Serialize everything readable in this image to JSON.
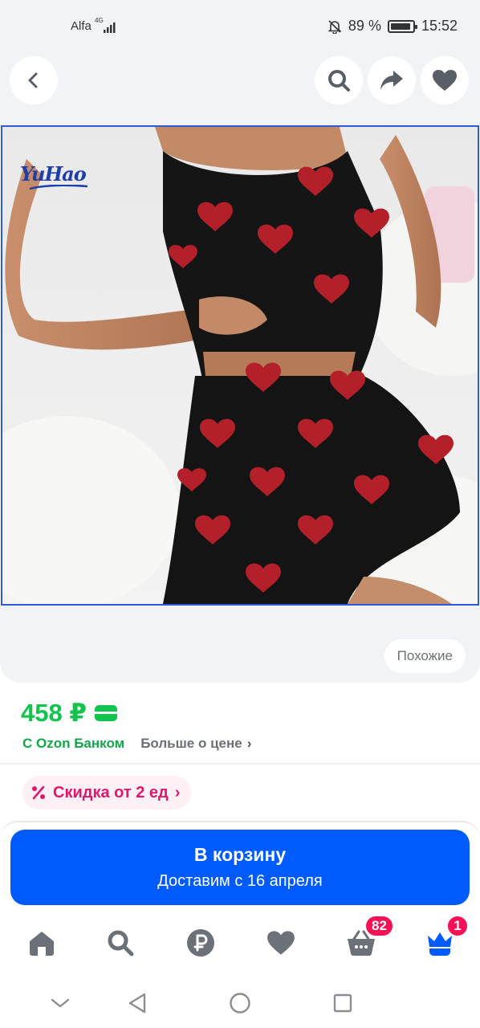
{
  "status_bar": {
    "carrier": "Alfa",
    "network": "4G",
    "battery": "89 %",
    "time": "15:52"
  },
  "top_nav": {
    "back_icon": "chevron-left-icon",
    "search_icon": "search-icon",
    "share_icon": "share-icon",
    "favorite_icon": "heart-icon"
  },
  "gallery": {
    "brand_logo": "YuHao",
    "similar_label": "Похожие"
  },
  "price": {
    "value": "458 ₽",
    "bank_label": "С Ozon Банком",
    "more_label": "Больше о цене",
    "more_chevron": "›"
  },
  "promo": {
    "discount_label": "Скидка от 2 ед",
    "chevron": "›"
  },
  "cart": {
    "button_label": "В корзину",
    "delivery_label": "Доставим с 16 апреля"
  },
  "bottom_nav": {
    "items": [
      {
        "icon": "home-icon"
      },
      {
        "icon": "search-icon"
      },
      {
        "icon": "ruble-icon"
      },
      {
        "icon": "heart-icon"
      },
      {
        "icon": "basket-icon",
        "badge": "82"
      },
      {
        "icon": "crown-profile-icon",
        "badge": "1"
      }
    ]
  },
  "colors": {
    "accent_blue": "#005bff",
    "price_green": "#10c44c",
    "promo_pink": "#e0186c",
    "badge_red": "#f91155"
  }
}
